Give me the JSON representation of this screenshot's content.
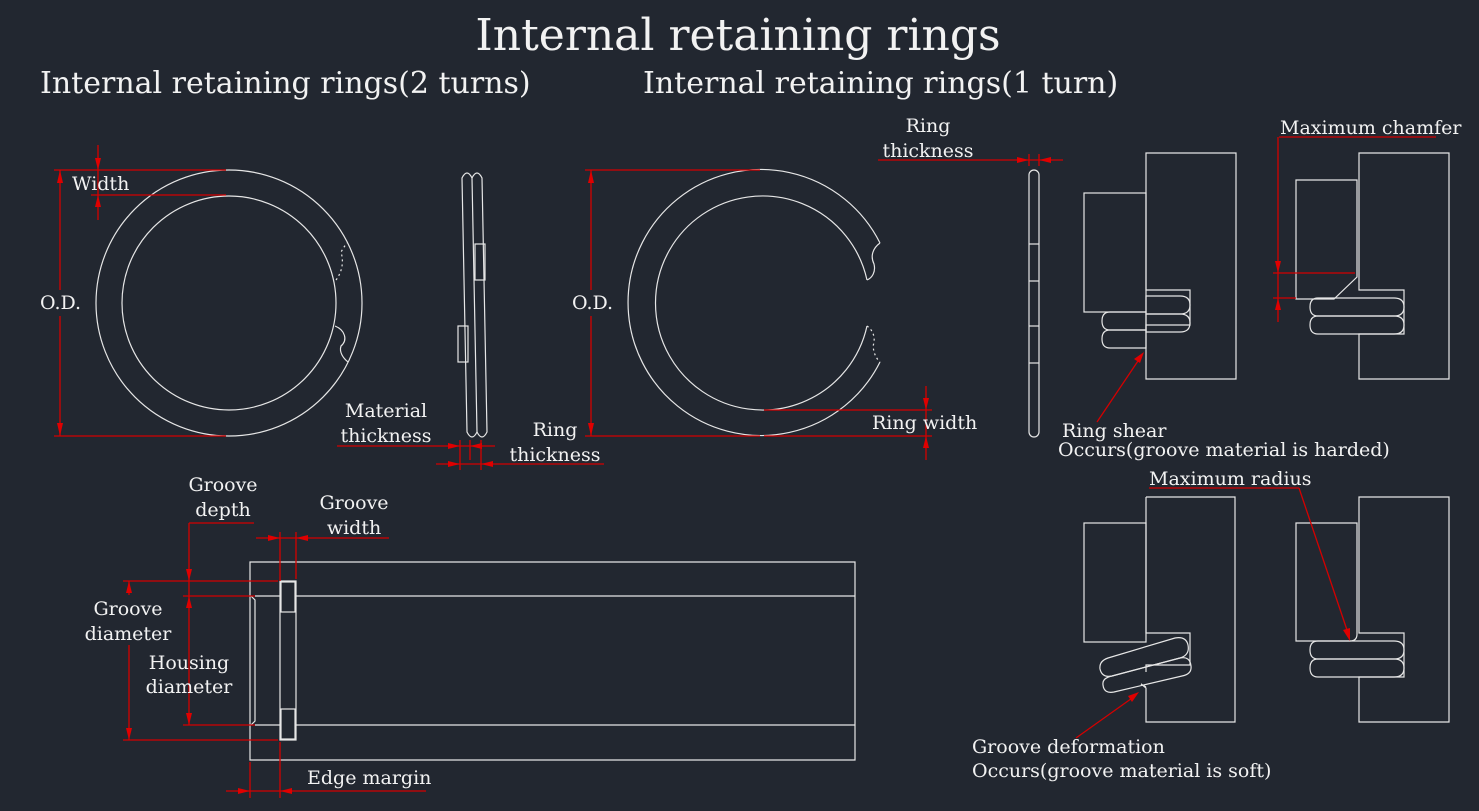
{
  "title": "Internal retaining rings",
  "subtitles": {
    "two_turns": "Internal retaining rings(2 turns)",
    "one_turn": "Internal retaining rings(1 turn)"
  },
  "labels": {
    "width": "Width",
    "od_left": "O.D.",
    "material_thickness_1": "Material",
    "material_thickness_2": "thickness",
    "ring_thickness_left_1": "Ring",
    "ring_thickness_left_2": "thickness",
    "od_right": "O.D.",
    "ring_width": "Ring width",
    "ring_thickness_right_1": "Ring",
    "ring_thickness_right_2": "thickness",
    "maximum_chamfer": "Maximum chamfer",
    "ring_shear": "Ring shear",
    "ring_shear_note": "Occurs(groove material is harded)",
    "maximum_radius": "Maximum radius",
    "groove_deformation": "Groove deformation",
    "groove_deformation_note": "Occurs(groove material is soft)",
    "groove_depth_1": "Groove",
    "groove_depth_2": "depth",
    "groove_width_1": "Groove",
    "groove_width_2": "width",
    "groove_diameter_1": "Groove",
    "groove_diameter_2": "diameter",
    "housing_diameter_1": "Housing",
    "housing_diameter_2": "diameter",
    "edge_margin": "Edge margin"
  },
  "colors": {
    "background": "#222730",
    "geometry": "#e6e6e6",
    "dimension": "#d40000"
  }
}
